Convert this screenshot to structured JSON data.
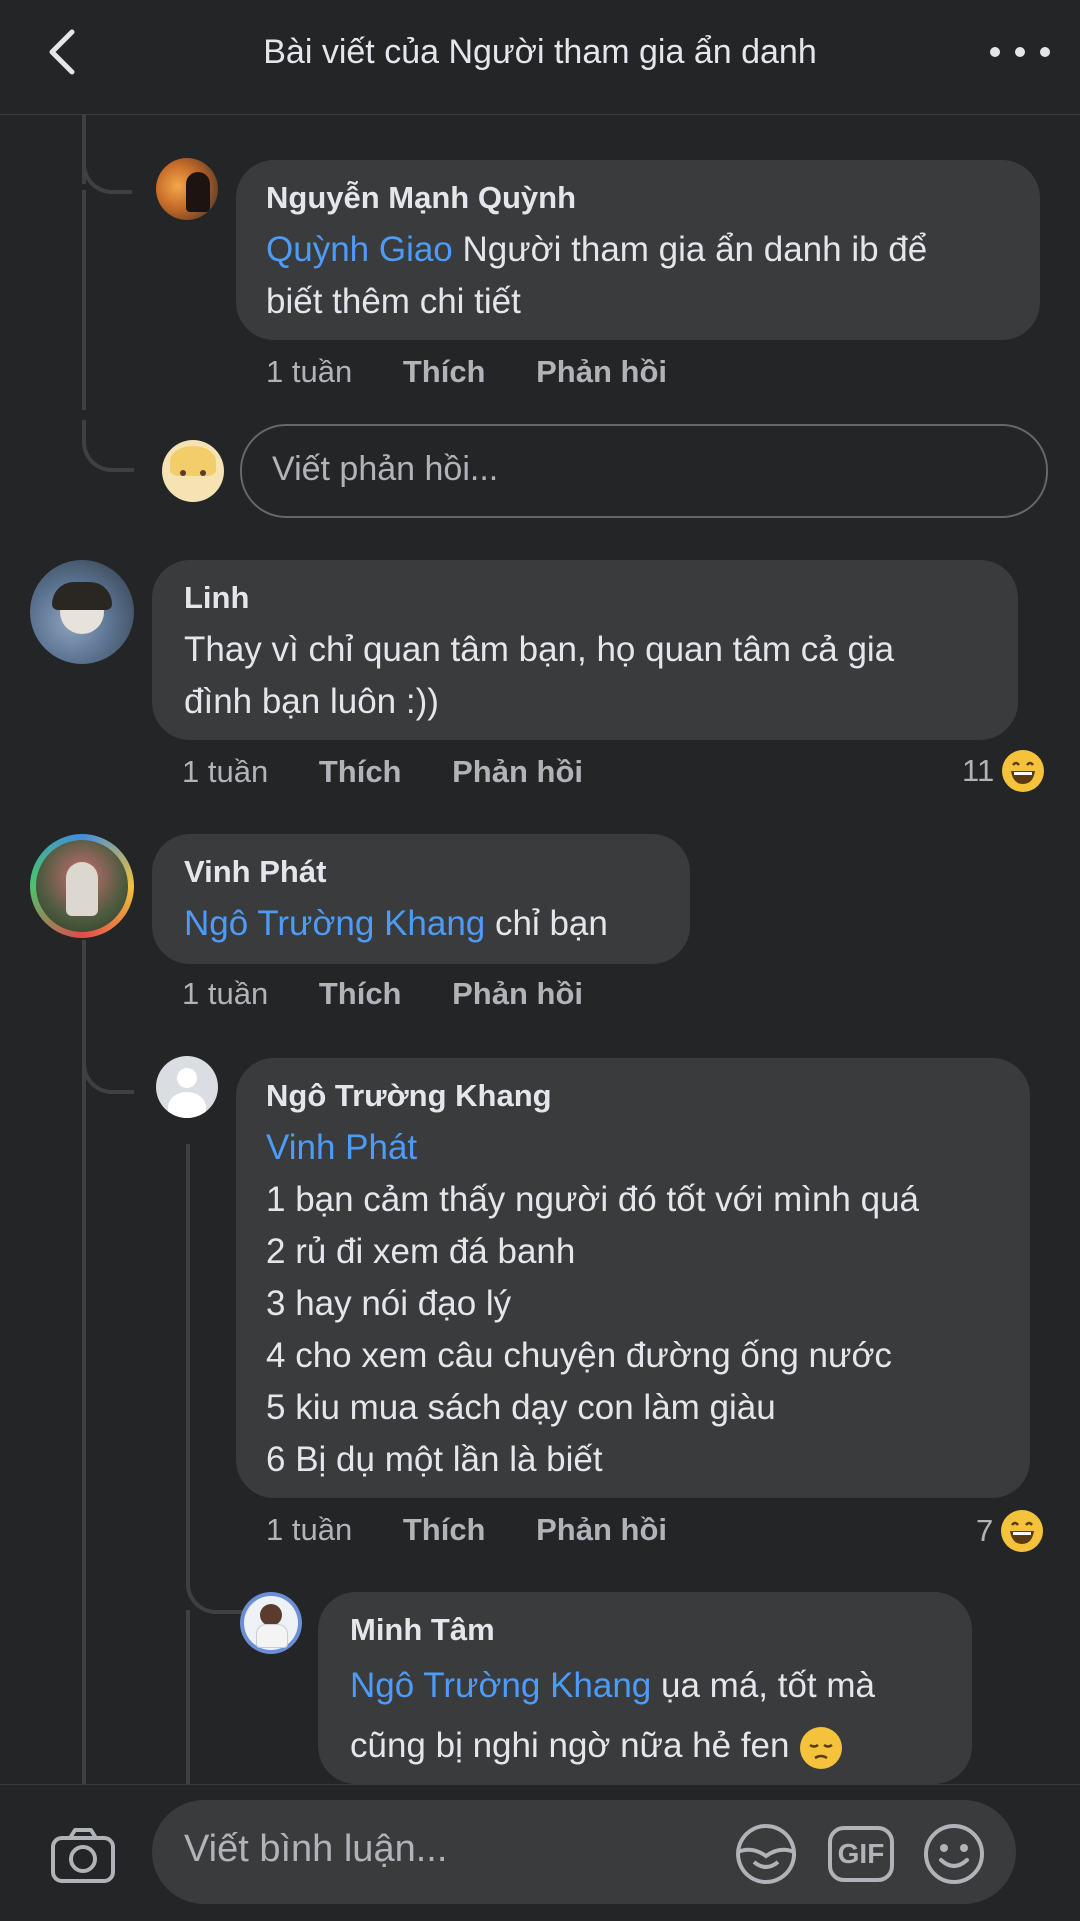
{
  "header": {
    "title": "Bài viết của Người tham gia ẩn danh",
    "back_icon": "chevron-left-icon",
    "more_icon": "more-horizontal-icon"
  },
  "comments": [
    {
      "author": "Nguyễn Mạnh Quỳnh",
      "mention": "Quỳnh Giao",
      "text_line1": " Người tham gia ẩn danh ib để",
      "text_line2": "biết thêm chi tiết",
      "time": "1 tuần",
      "like": "Thích",
      "reply": "Phản hồi"
    },
    {
      "author": "Linh",
      "text_line1": "Thay vì chỉ quan tâm bạn, họ quan tâm cả gia",
      "text_line2": "đình bạn luôn :))",
      "time": "1 tuần",
      "like": "Thích",
      "reply": "Phản hồi",
      "reaction_count": "11"
    },
    {
      "author": "Vinh Phát",
      "mention": "Ngô Trường Khang",
      "text_line1": " chỉ bạn",
      "time": "1 tuần",
      "like": "Thích",
      "reply": "Phản hồi"
    },
    {
      "author": "Ngô Trường Khang",
      "mention": "Vinh Phát",
      "lines": [
        "1 bạn cảm thấy người đó tốt với mình quá",
        "2 rủ đi xem đá banh",
        "3 hay nói đạo lý",
        "4 cho xem câu chuyện đường ống nước",
        "5 kiu mua sách dạy con làm giàu",
        "6 Bị dụ một lần là biết"
      ],
      "time": "1 tuần",
      "like": "Thích",
      "reply": "Phản hồi",
      "reaction_count": "7"
    },
    {
      "author": "Minh Tâm",
      "mention": "Ngô Trường Khang",
      "text_line1": " ụa má, tốt mà",
      "text_line2": "cũng bị nghi ngờ nữa hẻ fen"
    }
  ],
  "reply_input": {
    "placeholder": "Viết phản hồi..."
  },
  "comment_bar": {
    "placeholder": "Viết bình luận...",
    "camera_icon": "camera-icon",
    "sticker_icon": "sticker-icon",
    "gif_label": "GIF",
    "emoji_icon": "emoji-icon"
  },
  "colors": {
    "background": "#242526",
    "bubble": "#3a3b3c",
    "mention": "#4d9bf8",
    "secondary_text": "#b0b3b8"
  }
}
